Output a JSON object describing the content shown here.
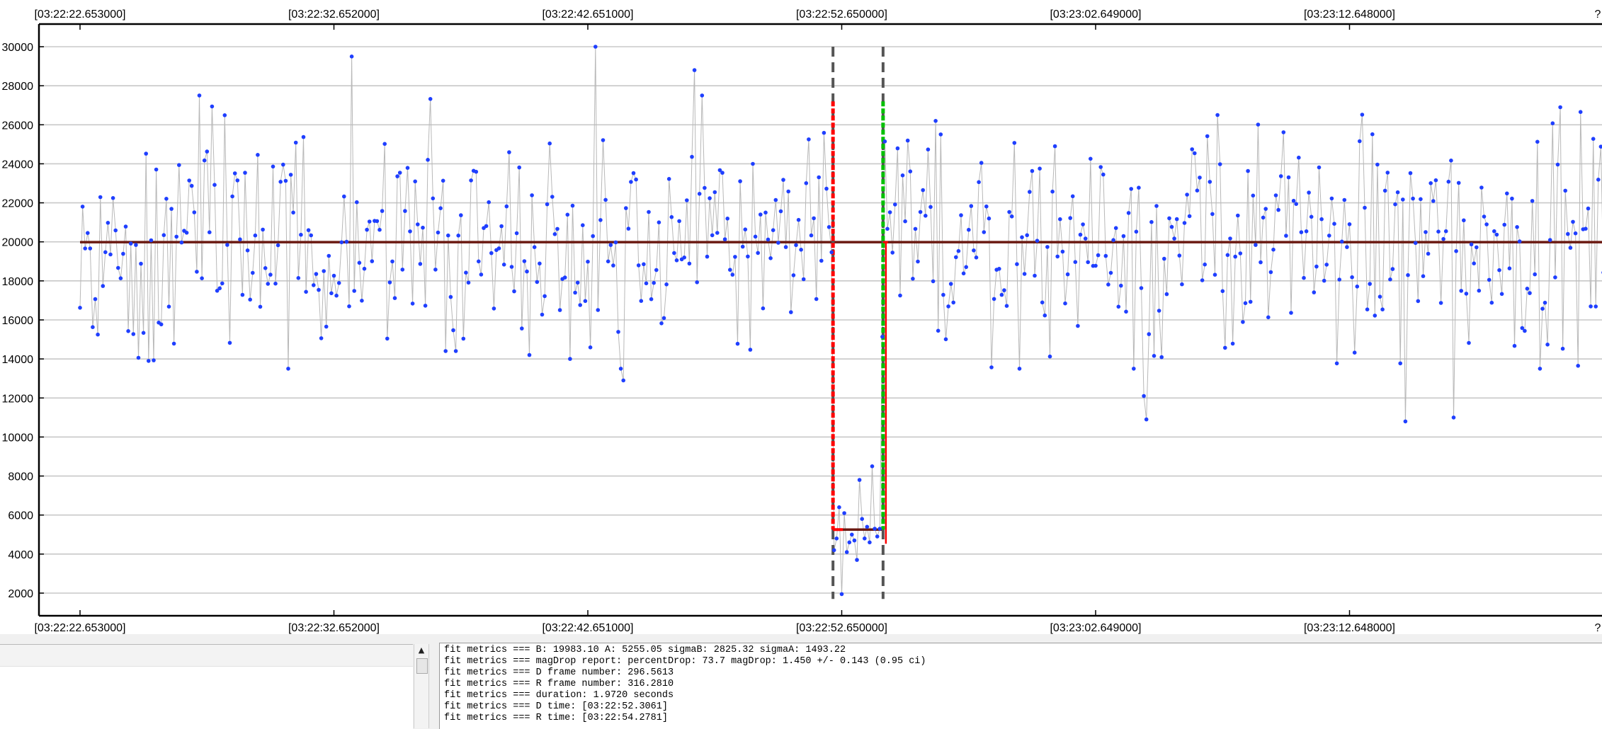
{
  "chart_data": {
    "type": "scatter",
    "x_tick_labels": [
      "[03:22:22.653000]",
      "[03:22:32.652000]",
      "[03:22:42.651000]",
      "[03:22:52.650000]",
      "[03:23:02.649000]",
      "[03:23:12.648000]",
      "?"
    ],
    "y_ticks": [
      2000,
      4000,
      6000,
      8000,
      10000,
      12000,
      14000,
      16000,
      18000,
      20000,
      22000,
      24000,
      26000,
      28000,
      30000
    ],
    "ylim": [
      1000,
      31000
    ],
    "x_frame_range": [
      0,
      600
    ],
    "frames_per_tick": 100,
    "grid": true,
    "seed": 20831,
    "baseline_B": 19983.1,
    "event_level_A": 5255.05,
    "D_frame": 296.5613,
    "R_frame": 316.281,
    "event_drop_points": [
      {
        "frame": 297,
        "y": 4200
      },
      {
        "frame": 298,
        "y": 4800
      },
      {
        "frame": 299,
        "y": 6400
      },
      {
        "frame": 300,
        "y": 1950
      },
      {
        "frame": 301,
        "y": 6100
      },
      {
        "frame": 302,
        "y": 4100
      },
      {
        "frame": 303,
        "y": 4600
      },
      {
        "frame": 304,
        "y": 5000
      },
      {
        "frame": 305,
        "y": 4700
      },
      {
        "frame": 306,
        "y": 3700
      },
      {
        "frame": 307,
        "y": 7800
      },
      {
        "frame": 308,
        "y": 5800
      },
      {
        "frame": 309,
        "y": 4800
      },
      {
        "frame": 310,
        "y": 5400
      },
      {
        "frame": 311,
        "y": 4600
      },
      {
        "frame": 312,
        "y": 8500
      },
      {
        "frame": 313,
        "y": 5300
      },
      {
        "frame": 314,
        "y": 4900
      },
      {
        "frame": 315,
        "y": 5300
      }
    ],
    "notable_points": [
      {
        "frame": 203,
        "y": 30000
      },
      {
        "frame": 107,
        "y": 29500
      },
      {
        "frame": 242,
        "y": 28800
      },
      {
        "frame": 583,
        "y": 26900
      },
      {
        "frame": 337,
        "y": 26200
      },
      {
        "frame": 448,
        "y": 26500
      },
      {
        "frame": 27,
        "y": 13900
      },
      {
        "frame": 214,
        "y": 12900
      },
      {
        "frame": 419,
        "y": 12100
      },
      {
        "frame": 420,
        "y": 10900
      },
      {
        "frame": 522,
        "y": 10800
      },
      {
        "frame": 541,
        "y": 11000
      }
    ],
    "colors": {
      "points": "#1f3fff",
      "connector": "#b8b8b8",
      "fit_line": "#6b1a12",
      "d_edge": "#ff0000",
      "r_edge": "#00c000",
      "dash_markers": "#555555",
      "grid": "#c8c8c8"
    }
  },
  "metrics": [
    "fit metrics === B: 19983.10 A: 5255.05 sigmaB: 2825.32 sigmaA: 1493.22",
    "fit metrics === magDrop report: percentDrop: 73.7 magDrop: 1.450 +/- 0.143 (0.95 ci)",
    "fit metrics === D frame number: 296.5613",
    "fit metrics === R frame number: 316.2810",
    "fit metrics === duration: 1.9720 seconds",
    "fit metrics === D time: [03:22:52.3061]",
    "fit metrics === R time: [03:22:54.2781]"
  ],
  "scrollbar": {
    "up_arrow": "▲"
  }
}
